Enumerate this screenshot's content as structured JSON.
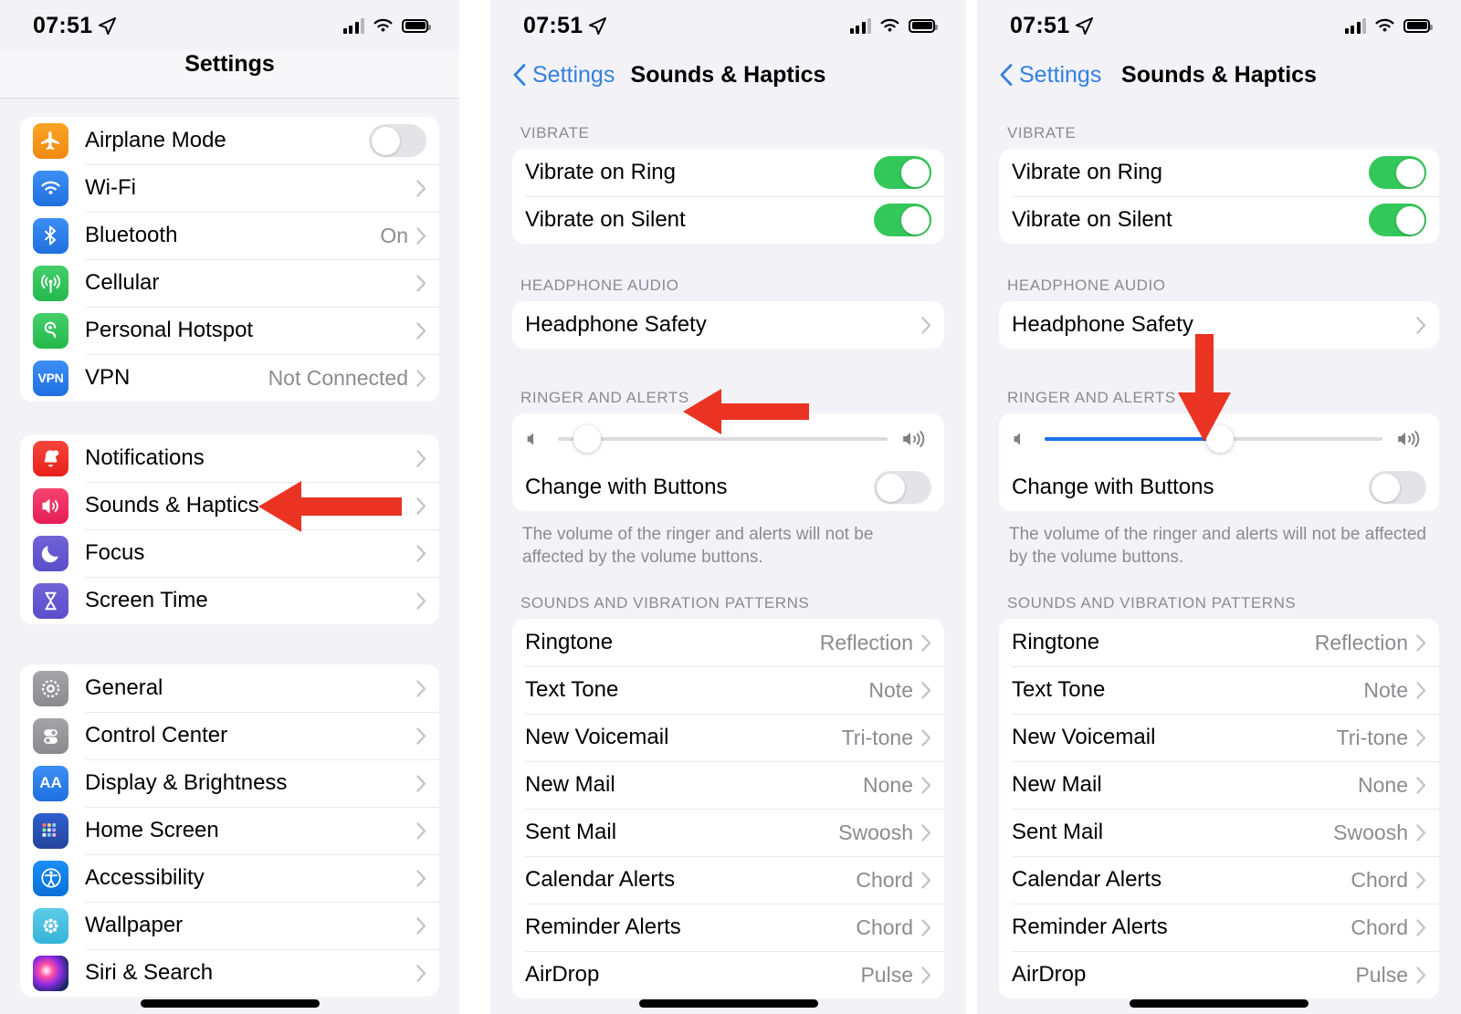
{
  "status_bar": {
    "time": "07:51",
    "location_icon": "location-arrow-icon",
    "signal_icon": "cellular-bars-icon",
    "wifi_icon": "wifi-icon",
    "battery_icon": "battery-icon"
  },
  "panel1": {
    "nav": {
      "title": "Settings"
    },
    "groups": [
      {
        "rows": [
          {
            "icon": "airplane-icon",
            "label": "Airplane Mode",
            "accessory": "toggle",
            "toggle_on": false
          },
          {
            "icon": "wifi-icon",
            "label": "Wi-Fi",
            "value": "",
            "accessory": "chevron"
          },
          {
            "icon": "bluetooth-icon",
            "label": "Bluetooth",
            "value": "On",
            "accessory": "chevron"
          },
          {
            "icon": "cellular-icon",
            "label": "Cellular",
            "value": "",
            "accessory": "chevron"
          },
          {
            "icon": "hotspot-icon",
            "label": "Personal Hotspot",
            "value": "",
            "accessory": "chevron"
          },
          {
            "icon": "vpn-icon",
            "label": "VPN",
            "value": "Not Connected",
            "accessory": "chevron"
          }
        ]
      },
      {
        "rows": [
          {
            "icon": "notifications-bell-icon",
            "label": "Notifications",
            "value": "",
            "accessory": "chevron"
          },
          {
            "icon": "sounds-haptics-speaker-icon",
            "label": "Sounds & Haptics",
            "value": "",
            "accessory": "chevron"
          },
          {
            "icon": "focus-moon-icon",
            "label": "Focus",
            "value": "",
            "accessory": "chevron"
          },
          {
            "icon": "screen-time-hourglass-icon",
            "label": "Screen Time",
            "value": "",
            "accessory": "chevron"
          }
        ]
      },
      {
        "rows": [
          {
            "icon": "general-gear-icon",
            "label": "General",
            "value": "",
            "accessory": "chevron"
          },
          {
            "icon": "control-center-icon",
            "label": "Control Center",
            "value": "",
            "accessory": "chevron"
          },
          {
            "icon": "display-brightness-aa-icon",
            "label": "Display & Brightness",
            "value": "",
            "accessory": "chevron"
          },
          {
            "icon": "home-screen-grid-icon",
            "label": "Home Screen",
            "value": "",
            "accessory": "chevron"
          },
          {
            "icon": "accessibility-icon",
            "label": "Accessibility",
            "value": "",
            "accessory": "chevron"
          },
          {
            "icon": "wallpaper-flower-icon",
            "label": "Wallpaper",
            "value": "",
            "accessory": "chevron"
          },
          {
            "icon": "siri-search-icon",
            "label": "Siri & Search",
            "value": "",
            "accessory": "chevron"
          }
        ]
      }
    ]
  },
  "panel2": {
    "nav": {
      "back_label": "Settings",
      "title": "Sounds & Haptics",
      "back_icon": "chevron-left-icon"
    },
    "sections": {
      "vibrate_header": "VIBRATE",
      "vibrate_rows": [
        {
          "label": "Vibrate on Ring",
          "toggle_on": true
        },
        {
          "label": "Vibrate on Silent",
          "toggle_on": true
        }
      ],
      "headphone_header": "HEADPHONE AUDIO",
      "headphone_row": {
        "label": "Headphone Safety"
      },
      "ringer_header": "RINGER AND ALERTS",
      "slider": {
        "value_percent": 9,
        "filled": false,
        "left_icon": "speaker-low-icon",
        "right_icon": "speaker-high-icon"
      },
      "change_with_buttons": {
        "label": "Change with Buttons",
        "toggle_on": false
      },
      "footnote": "The volume of the ringer and alerts will not be affected by the volume buttons.",
      "patterns_header": "SOUNDS AND VIBRATION PATTERNS",
      "pattern_rows": [
        {
          "label": "Ringtone",
          "value": "Reflection"
        },
        {
          "label": "Text Tone",
          "value": "Note"
        },
        {
          "label": "New Voicemail",
          "value": "Tri-tone"
        },
        {
          "label": "New Mail",
          "value": "None"
        },
        {
          "label": "Sent Mail",
          "value": "Swoosh"
        },
        {
          "label": "Calendar Alerts",
          "value": "Chord"
        },
        {
          "label": "Reminder Alerts",
          "value": "Chord"
        },
        {
          "label": "AirDrop",
          "value": "Pulse"
        }
      ]
    }
  },
  "panel3": {
    "nav": {
      "back_label": "Settings",
      "title": "Sounds & Haptics",
      "back_icon": "chevron-left-icon"
    },
    "sections": {
      "vibrate_header": "VIBRATE",
      "vibrate_rows": [
        {
          "label": "Vibrate on Ring",
          "toggle_on": true
        },
        {
          "label": "Vibrate on Silent",
          "toggle_on": true
        }
      ],
      "headphone_header": "HEADPHONE AUDIO",
      "headphone_row": {
        "label": "Headphone Safety"
      },
      "ringer_header": "RINGER AND ALERTS",
      "slider": {
        "value_percent": 52,
        "filled": true,
        "left_icon": "speaker-low-icon",
        "right_icon": "speaker-high-icon"
      },
      "change_with_buttons": {
        "label": "Change with Buttons",
        "toggle_on": false
      },
      "footnote": "The volume of the ringer and alerts will not be affected by the volume buttons.",
      "patterns_header": "SOUNDS AND VIBRATION PATTERNS",
      "pattern_rows": [
        {
          "label": "Ringtone",
          "value": "Reflection"
        },
        {
          "label": "Text Tone",
          "value": "Note"
        },
        {
          "label": "New Voicemail",
          "value": "Tri-tone"
        },
        {
          "label": "New Mail",
          "value": "None"
        },
        {
          "label": "Sent Mail",
          "value": "Swoosh"
        },
        {
          "label": "Calendar Alerts",
          "value": "Chord"
        },
        {
          "label": "Reminder Alerts",
          "value": "Chord"
        },
        {
          "label": "AirDrop",
          "value": "Pulse"
        }
      ]
    }
  },
  "annotations": {
    "color": "#EA3323",
    "arrows": [
      {
        "name": "arrow-to-sounds-haptics",
        "direction": "left"
      },
      {
        "name": "arrow-to-ringer-and-alerts",
        "direction": "left"
      },
      {
        "name": "arrow-to-volume-slider",
        "direction": "down"
      }
    ]
  },
  "colors": {
    "accent_blue": "#3581dd",
    "slider_blue": "#1b70e8",
    "toggle_green": "#34c759",
    "annotation_red": "#EA3323",
    "page_bg": "#f2f2f7"
  }
}
